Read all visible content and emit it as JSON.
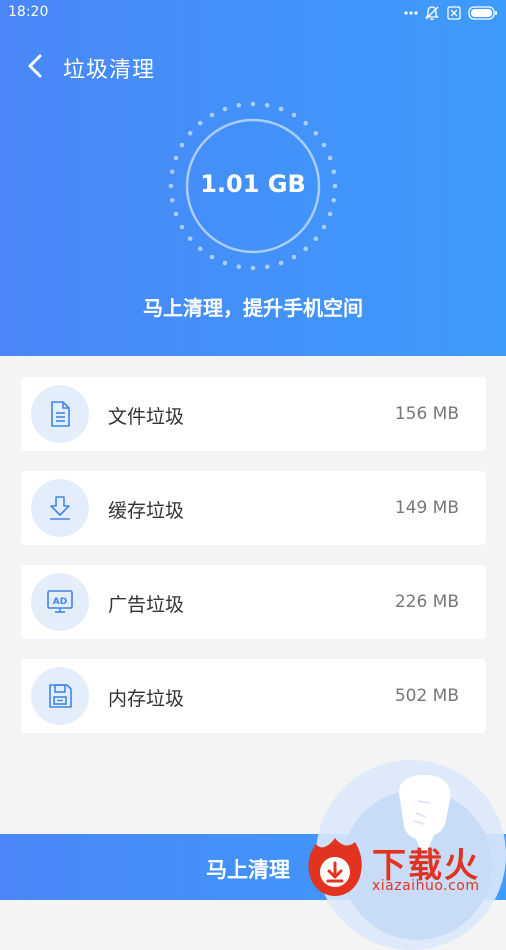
{
  "status_bar": {
    "time": "18:20"
  },
  "header": {
    "title": "垃圾清理"
  },
  "summary": {
    "total_size": "1.01 GB",
    "subtitle": "马上清理，提升手机空间"
  },
  "junk_items": [
    {
      "label": "文件垃圾",
      "size": "156 MB",
      "icon": "document-icon"
    },
    {
      "label": "缓存垃圾",
      "size": "149 MB",
      "icon": "download-icon"
    },
    {
      "label": "广告垃圾",
      "size": "226 MB",
      "icon": "ad-icon"
    },
    {
      "label": "内存垃圾",
      "size": "502 MB",
      "icon": "floppy-disk-icon"
    }
  ],
  "action": {
    "clean_label": "马上清理"
  },
  "watermark": {
    "title": "下载火",
    "url": "xiazaihuo.com"
  },
  "colors": {
    "accent": "#4a86f7",
    "icon_bg": "#e4eefb",
    "icon_stroke": "#3f86e8",
    "watermark": "#e1331f"
  }
}
